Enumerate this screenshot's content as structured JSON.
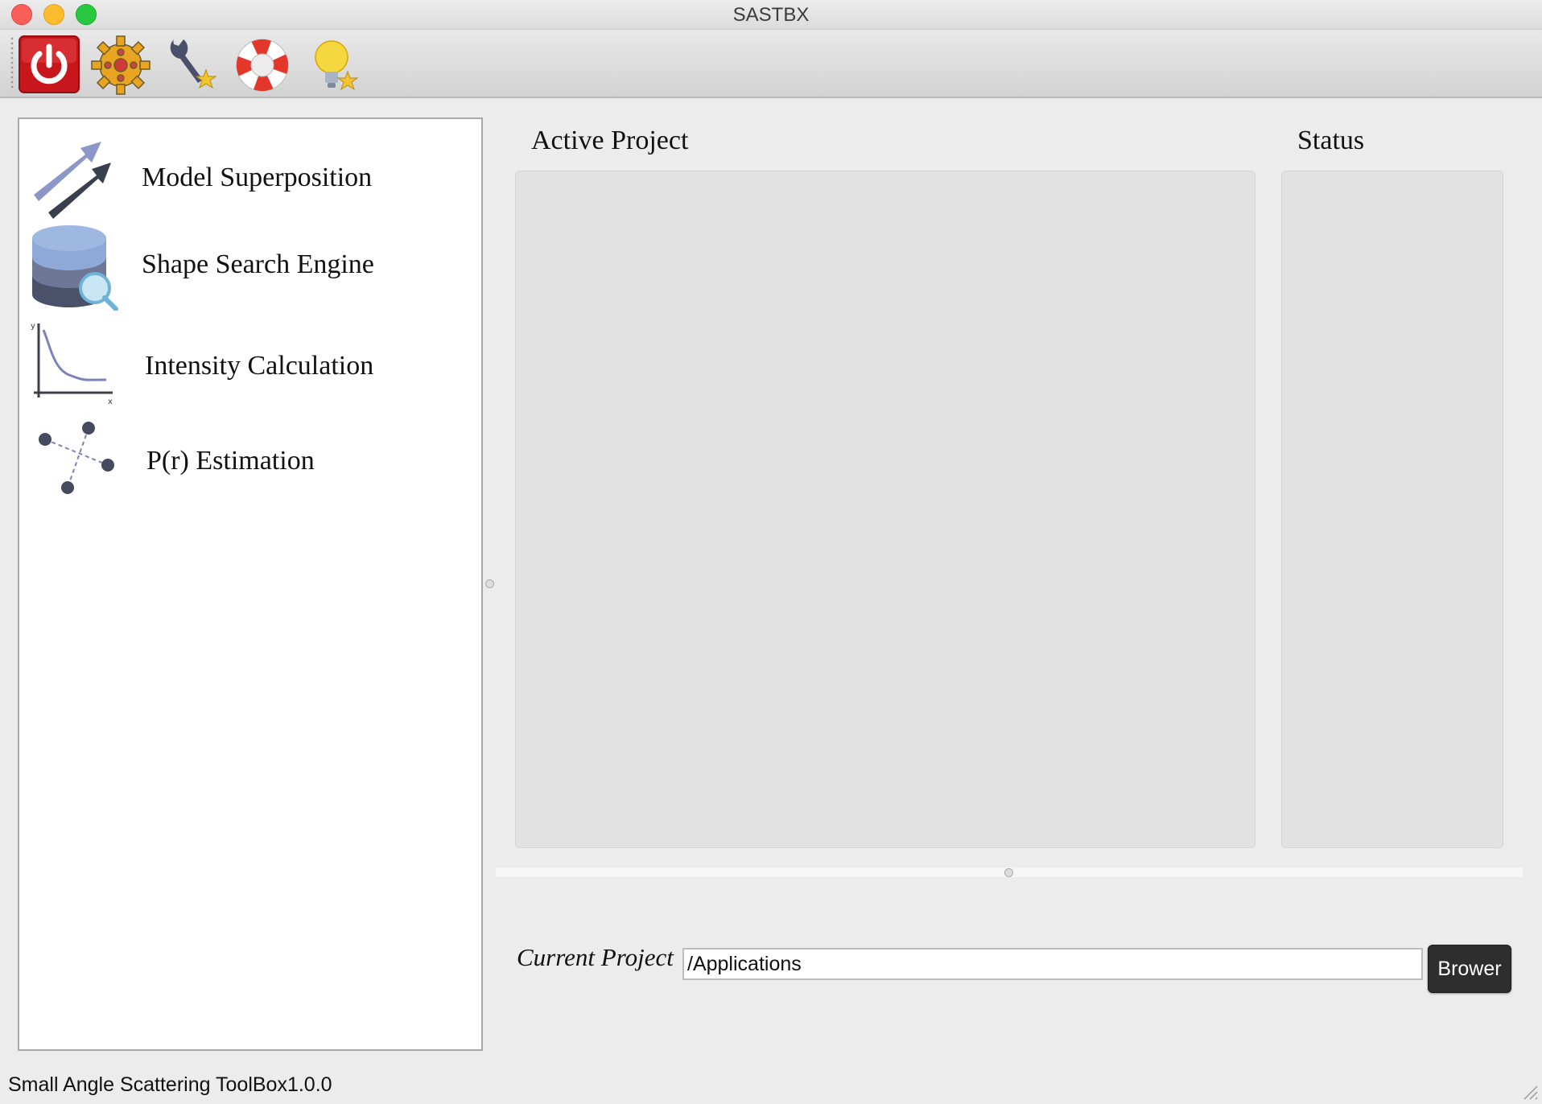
{
  "window": {
    "title": "SASTBX"
  },
  "toolbar": {
    "items": [
      {
        "name": "power",
        "icon": "power-icon"
      },
      {
        "name": "settings",
        "icon": "gear-icon"
      },
      {
        "name": "tools",
        "icon": "wrench-star-icon"
      },
      {
        "name": "help",
        "icon": "lifebuoy-icon"
      },
      {
        "name": "tips",
        "icon": "lightbulb-star-icon"
      }
    ]
  },
  "sidebar": {
    "items": [
      {
        "label": "Model Superposition",
        "icon": "arrows-icon"
      },
      {
        "label": "Shape Search Engine",
        "icon": "database-search-icon"
      },
      {
        "label": "Intensity Calculation",
        "icon": "intensity-plot-icon"
      },
      {
        "label": "P(r) Estimation",
        "icon": "pr-distance-icon"
      }
    ]
  },
  "main": {
    "active_project_title": "Active Project",
    "status_title": "Status"
  },
  "current_project": {
    "label": "Current Project",
    "value": "/Applications",
    "browse_label": "Brower"
  },
  "statusbar": {
    "text": "Small Angle Scattering ToolBox1.0.0"
  },
  "colors": {
    "accent_red": "#d8262d",
    "window_bg": "#ececec",
    "panel_bg": "#e2e2e2"
  }
}
